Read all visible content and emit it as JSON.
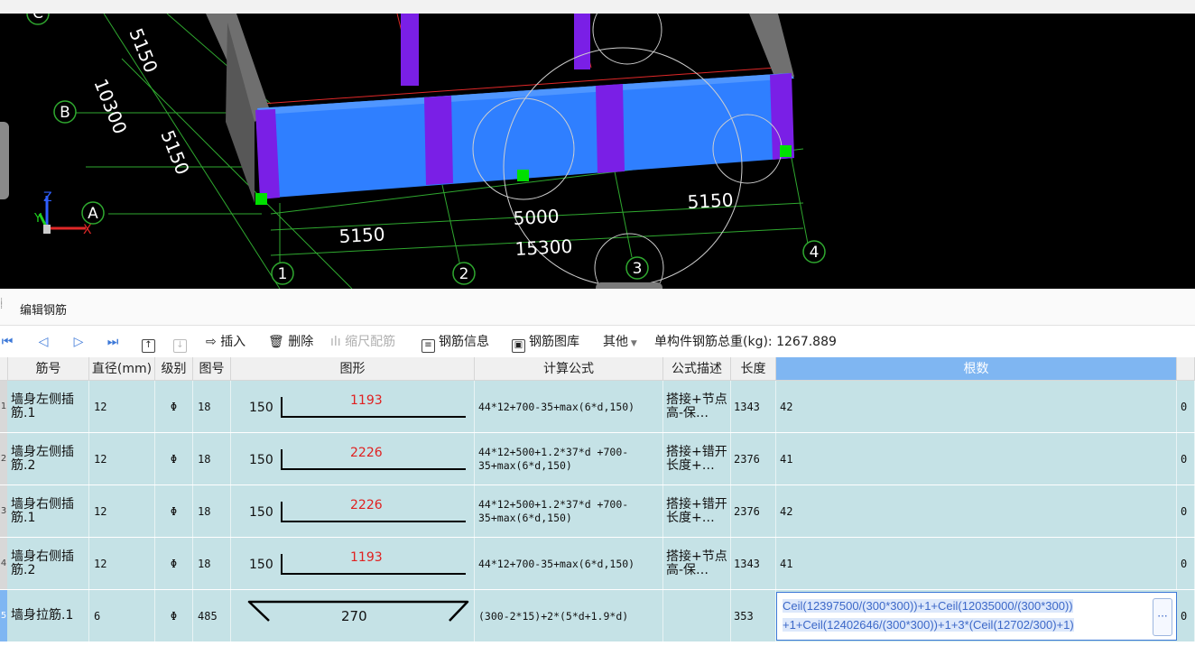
{
  "viewport": {
    "axis_labels": [
      "A",
      "B",
      "C",
      "1",
      "2",
      "3",
      "4"
    ],
    "dimensions": [
      "5150",
      "10300",
      "5150",
      "5150",
      "5000",
      "5150",
      "15300"
    ],
    "gizmo": {
      "z": "Z",
      "y": "Y",
      "x": "X"
    }
  },
  "panel": {
    "title": "编辑钢筋"
  },
  "toolbar": {
    "insert": "插入",
    "delete": "删除",
    "scale_rebar": "缩尺配筋",
    "rebar_info": "钢筋信息",
    "rebar_library": "钢筋图库",
    "other": "其他",
    "total_weight_label": "单构件钢筋总重(kg):",
    "total_weight_value": "1267.889"
  },
  "table": {
    "headers": {
      "bar_no": "筋号",
      "diameter": "直径(mm)",
      "grade": "级别",
      "shape_no": "图号",
      "shape": "图形",
      "formula": "计算公式",
      "formula_desc": "公式描述",
      "length": "长度",
      "count": "根数"
    },
    "rows": [
      {
        "index": "1",
        "bar_no": "墙身左侧插筋.1",
        "diameter": "12",
        "grade": "Φ",
        "shape_no": "18",
        "shape_left": "150",
        "shape_len": "1193",
        "formula": "44*12+700-35+max(6*d,150)",
        "formula_desc": "搭接+节点高-保…",
        "length": "1343",
        "count": "42",
        "extra": "0"
      },
      {
        "index": "2",
        "bar_no": "墙身左侧插筋.2",
        "diameter": "12",
        "grade": "Φ",
        "shape_no": "18",
        "shape_left": "150",
        "shape_len": "2226",
        "formula": "44*12+500+1.2*37*d +700-35+max(6*d,150)",
        "formula_desc": "搭接+错开长度+…",
        "length": "2376",
        "count": "41",
        "extra": "0"
      },
      {
        "index": "3",
        "bar_no": "墙身右侧插筋.1",
        "diameter": "12",
        "grade": "Φ",
        "shape_no": "18",
        "shape_left": "150",
        "shape_len": "2226",
        "formula": "44*12+500+1.2*37*d +700-35+max(6*d,150)",
        "formula_desc": "搭接+错开长度+…",
        "length": "2376",
        "count": "42",
        "extra": "0"
      },
      {
        "index": "4",
        "bar_no": "墙身右侧插筋.2",
        "diameter": "12",
        "grade": "Φ",
        "shape_no": "18",
        "shape_left": "150",
        "shape_len": "1193",
        "formula": "44*12+700-35+max(6*d,150)",
        "formula_desc": "搭接+节点高-保…",
        "length": "1343",
        "count": "41",
        "extra": "0"
      },
      {
        "index": "5",
        "bar_no": "墙身拉筋.1",
        "diameter": "6",
        "grade": "Φ",
        "shape_no": "485",
        "shape_len": "270",
        "formula": "(300-2*15)+2*(5*d+1.9*d)",
        "formula_desc": "",
        "length": "353",
        "count": "Ceil(12397500/(300*300))+1+Ceil(12035000/(300*300)) +1+Ceil(12402646/(300*300))+1+3*(Ceil(12702/300)+1)",
        "extra": "0"
      }
    ]
  },
  "colors": {
    "viewport_bg": "#000000",
    "wall_blue": "#2f7fff",
    "column_purple": "#7a1fe6",
    "grid_green": "#2fa82f",
    "selected_header": "#7fb6f2",
    "row_bg": "#c5e2e6",
    "red_length": "#e02020"
  }
}
